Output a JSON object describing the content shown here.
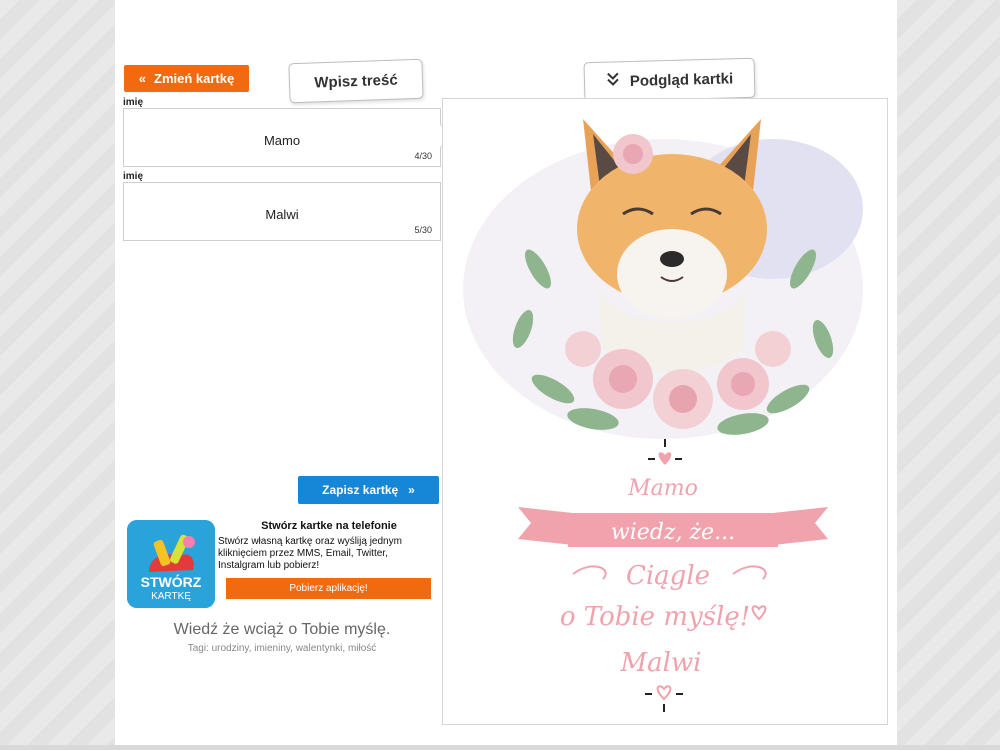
{
  "toolbar": {
    "change_card_label": "Zmień kartkę",
    "input_tab_label": "Wpisz treść",
    "preview_tab_label": "Podgląd kartki",
    "save_card_label": "Zapisz kartkę"
  },
  "fields": [
    {
      "label": "imię",
      "value": "Mamo",
      "count": "4/30"
    },
    {
      "label": "imię",
      "value": "Malwi",
      "count": "5/30"
    }
  ],
  "promo": {
    "title": "Stwórz kartke na telefonie",
    "description": "Stwórz własną kartkę oraz wyśliją jednym kliknięciem przez MMS, Email, Twitter, Instalgram lub pobierz!",
    "button_label": "Pobierz aplikację!",
    "icon_line1": "STWÓRZ",
    "icon_line2": "KARTKĘ"
  },
  "card": {
    "caption": "Wiedź że wciąż o Tobie myślę.",
    "tags": "Tagi: urodziny, imieniny, walentynki, miłość",
    "greeting": "Mamo",
    "banner_text": "wiedz, że...",
    "line2": "Ciągle",
    "line3": "o Tobie myślę!",
    "signature": "Malwi"
  },
  "colors": {
    "orange": "#f26a10",
    "blue": "#1686d6",
    "pink": "#f0a3ad"
  },
  "icons": {
    "change_card": "double-chevron-left-icon",
    "preview": "double-chevron-down-icon",
    "save": "double-chevron-right-icon"
  }
}
